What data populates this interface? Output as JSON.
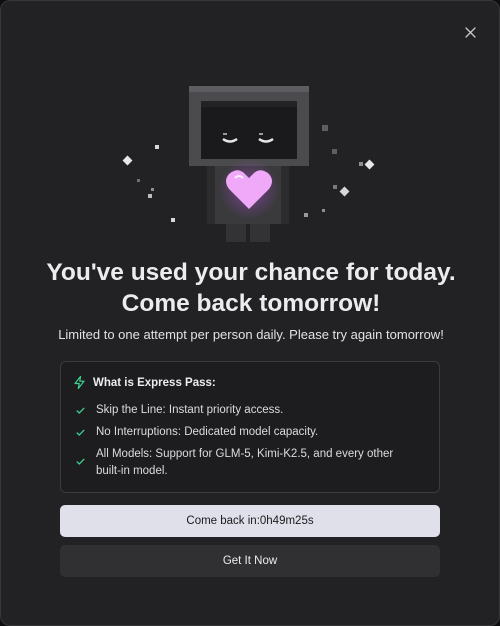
{
  "dialog": {
    "close_icon": "close-icon",
    "title": "You've used your chance for today. Come back tomorrow!",
    "subtitle": "Limited to one attempt per person daily. Please try again tomorrow!"
  },
  "express_pass": {
    "header_icon": "lightning-bolt-icon",
    "header": "What is Express Pass:",
    "features": [
      "Skip the Line: Instant priority access.",
      "No Interruptions: Dedicated model capacity.",
      "All Models: Support for GLM-5, Kimi-K2.5, and every other built-in model."
    ]
  },
  "buttons": {
    "come_back_label": "Come back in:0h49m25s",
    "get_it_now_label": "Get It Now"
  },
  "colors": {
    "background": "#222224",
    "accent_green": "#3ecf8e",
    "heart": "#f0a8f8",
    "primary_button": "#dfe0ea",
    "secondary_button": "#303033"
  }
}
